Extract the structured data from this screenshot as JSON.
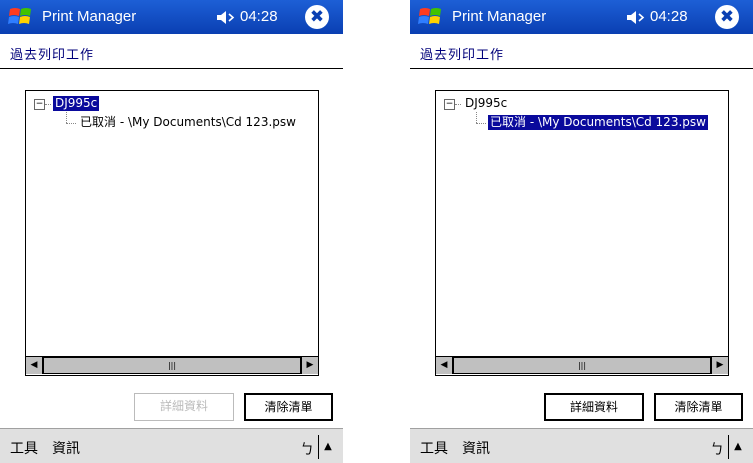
{
  "titlebar": {
    "app_title": "Print Manager",
    "clock": "04:28",
    "close_glyph": "✖"
  },
  "section": {
    "title": "過去列印工作"
  },
  "tree": {
    "printer": "DJ995c",
    "expander_glyph": "−",
    "job": "已取消 - \\My Documents\\Cd 123.psw"
  },
  "scrollbar": {
    "left_glyph": "◀",
    "right_glyph": "▶",
    "thumb_glyph": "|||"
  },
  "buttons": {
    "details": "詳細資料",
    "clear": "清除清單"
  },
  "menubar": {
    "tools": "工具",
    "info": "資訊",
    "sip_glyph": "ㄅ",
    "up_glyph": "▲"
  },
  "screens": [
    {
      "selected": "printer",
      "details_enabled": false
    },
    {
      "selected": "job",
      "details_enabled": true
    }
  ],
  "colors": {
    "titlebar": "#0a3fb2",
    "selection": "#0a0a9c",
    "menubar": "#e0e0e0"
  }
}
